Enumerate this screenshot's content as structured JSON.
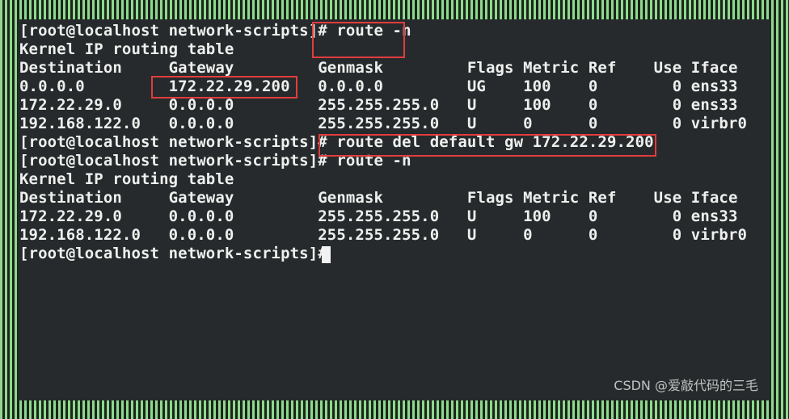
{
  "terminal": {
    "lines": [
      "[root@localhost network-scripts]# route -n",
      "Kernel IP routing table",
      "Destination     Gateway         Genmask         Flags Metric Ref    Use Iface",
      "0.0.0.0         172.22.29.200   0.0.0.0         UG    100    0        0 ens33",
      "172.22.29.0     0.0.0.0         255.255.255.0   U     100    0        0 ens33",
      "192.168.122.0   0.0.0.0         255.255.255.0   U     0      0        0 virbr0",
      "[root@localhost network-scripts]# route del default gw 172.22.29.200",
      "[root@localhost network-scripts]# route -n",
      "Kernel IP routing table",
      "Destination     Gateway         Genmask         Flags Metric Ref    Use Iface",
      "172.22.29.0     0.0.0.0         255.255.255.0   U     100    0        0 ens33",
      "192.168.122.0   0.0.0.0         255.255.255.0   U     0      0        0 virbr0",
      "[root@localhost network-scripts]# "
    ]
  },
  "colors": {
    "terminal_bg": "#262a2c",
    "text": "#eef0ee",
    "highlight_box": "#e23d3d",
    "border_stripes": "#8fd88f"
  },
  "watermark": "CSDN @爱敲代码的三毛"
}
